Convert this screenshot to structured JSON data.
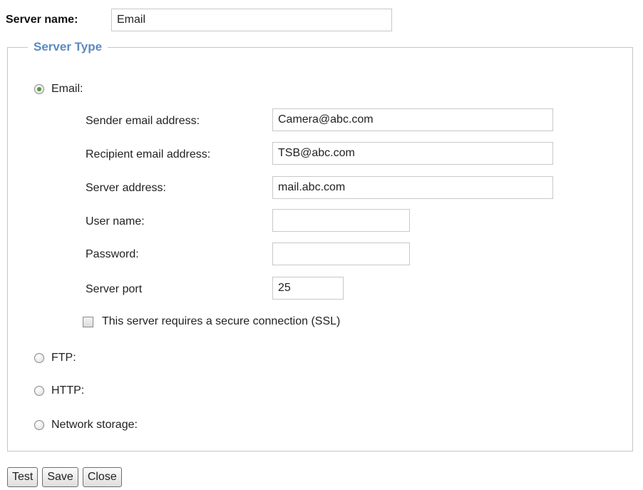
{
  "server_name": {
    "label": "Server name:",
    "value": "Email"
  },
  "server_type": {
    "legend": "Server Type",
    "email": {
      "label": "Email:",
      "selected": true,
      "fields": {
        "sender": {
          "label": "Sender email address:",
          "value": "Camera@abc.com"
        },
        "recipient": {
          "label": "Recipient email address:",
          "value": "TSB@abc.com"
        },
        "server_address": {
          "label": "Server address:",
          "value": "mail.abc.com"
        },
        "user_name": {
          "label": "User name:",
          "value": ""
        },
        "password": {
          "label": "Password:",
          "value": ""
        },
        "server_port": {
          "label": "Server port",
          "value": "25"
        }
      },
      "ssl": {
        "label": "This server requires a secure connection (SSL)",
        "checked": false
      }
    },
    "ftp": {
      "label": "FTP:"
    },
    "http": {
      "label": "HTTP:"
    },
    "network_storage": {
      "label": "Network storage:"
    }
  },
  "buttons": {
    "test": "Test",
    "save": "Save",
    "close": "Close"
  },
  "colors": {
    "legend": "#5b8ac0",
    "radio_selected": "#4f9a3c"
  }
}
